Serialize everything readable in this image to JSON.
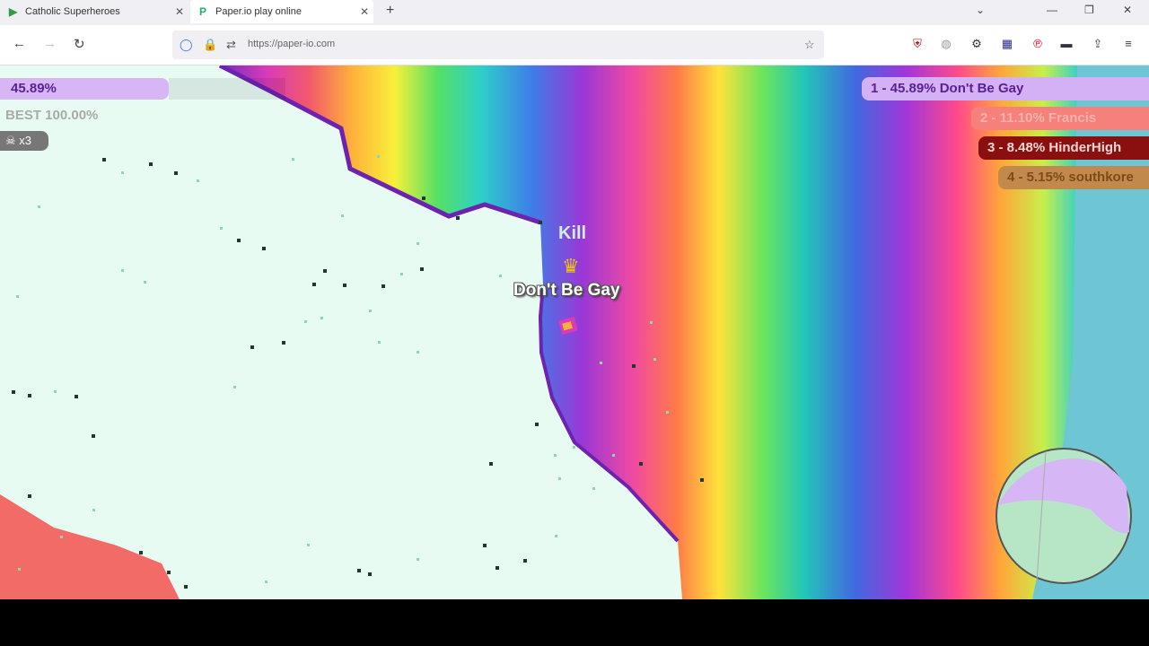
{
  "browser": {
    "tabs": [
      {
        "title": "Catholic Superheroes",
        "icon": "play-icon",
        "active": false
      },
      {
        "title": "Paper.io play online",
        "icon": "paperio-icon",
        "active": true
      }
    ],
    "url": "https://paper-io.com"
  },
  "hud": {
    "percent": "45.89%",
    "percent_value": 45.89,
    "best": "BEST 100.00%",
    "kills": "x3"
  },
  "leaderboard": [
    {
      "label": "1 - 45.89% Don't Be Gay",
      "color": "#d4b0f5"
    },
    {
      "label": "2 - 11.10% Francis",
      "color": "#f6817a"
    },
    {
      "label": "3 - 8.48% HinderHigh",
      "color": "#8a0f0f"
    },
    {
      "label": "4 - 5.15% southkore",
      "color": "#c2894d"
    }
  ],
  "player": {
    "name": "Don't Be Gay",
    "kill_text": "Kill",
    "color": "#7b2fbf"
  },
  "colors": {
    "territory_bg": "#e8fbf3",
    "enemy_territory": "#f26b66",
    "border_purple": "#6d22b0",
    "sea": "#6ec5d3"
  }
}
